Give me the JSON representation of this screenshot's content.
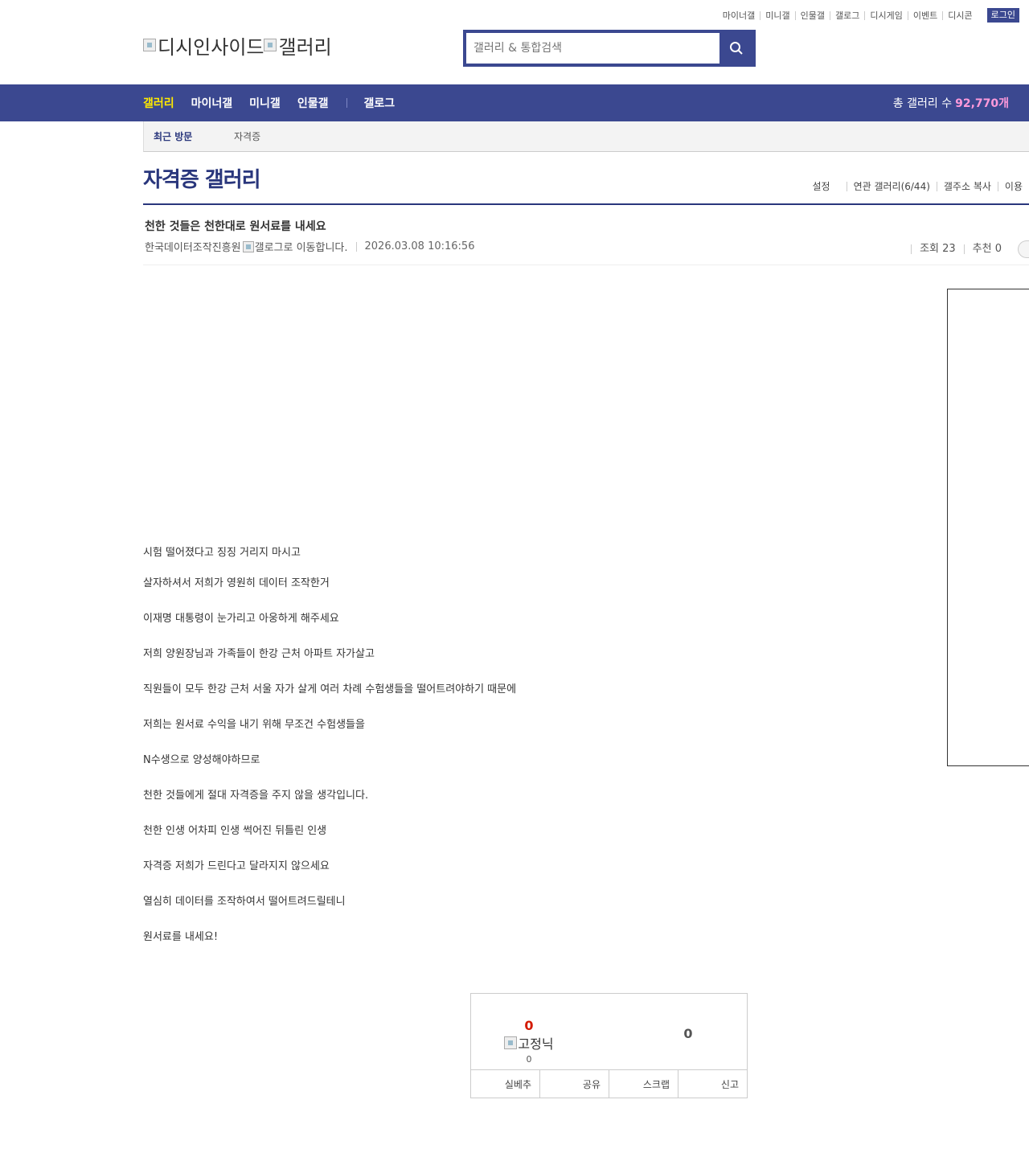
{
  "top_menu": [
    "마이너갤",
    "미니갤",
    "인물갤",
    "갤로그",
    "디시게임",
    "이벤트",
    "디시콘"
  ],
  "login_label": "로그인",
  "logo": {
    "site_alt": "디시인사이드",
    "gallery_alt": "갤러리"
  },
  "search": {
    "placeholder": "갤러리 & 통합검색"
  },
  "nav": {
    "items": [
      "갤러리",
      "마이너갤",
      "미니갤",
      "인물갤"
    ],
    "gallog": "갤로그",
    "count_label": "총 갤러리 수",
    "count_value": "92,770개"
  },
  "recent": {
    "title": "최근 방문",
    "items": [
      "자격증"
    ]
  },
  "gallery": {
    "title": "자격증 갤러리",
    "options": [
      "설정",
      "연관 갤러리(6/44)",
      "갤주소 복사",
      "이용"
    ]
  },
  "post": {
    "title": "천한 것들은 천한대로 원서료를 내세요",
    "author": "한국데이터조작진흥원",
    "gallog_alt": "갤로그로 이동합니다.",
    "datetime": "2026.03.08 10:16:56",
    "views_label": "조회 23",
    "recommend_label": "추천 0",
    "body": [
      "시험 떨어졌다고 징징 거리지 마시고",
      "살자하셔서 저희가 영원히 데이터 조작한거",
      "이재명 대통령이 눈가리고 아웅하게 해주세요",
      "저희 양원장님과 가족들이 한강 근처 아파트 자가살고",
      "직원들이 모두 한강 근처 서울 자가 살게 여러 차례 수험생들을 떨어트려야하기 때문에",
      "저희는 원서료 수익을 내기 위해 무조건 수험생들을",
      "N수생으로 양성해야하므로",
      "천한 것들에게 절대 자격증을 주지 않을 생각입니다.",
      "천한 인생 어차피 인생 썩어진 뒤틀린 인생",
      "자격증 저희가 드린다고 달라지지 않으세요",
      "열심히 데이터를 조작하여서 떨어트려드릴테니",
      "원서료를 내세요!"
    ]
  },
  "recommend": {
    "up_count": "0",
    "fixed_alt": "고정닉",
    "fixed_count": "0",
    "down_count": "0",
    "buttons": [
      "실베추",
      "공유",
      "스크랩",
      "신고"
    ]
  },
  "colors": {
    "brand": "#3b4890",
    "title": "#29367c",
    "nav_active": "#ffea00",
    "count": "#ff9adb",
    "up": "#d31900"
  }
}
